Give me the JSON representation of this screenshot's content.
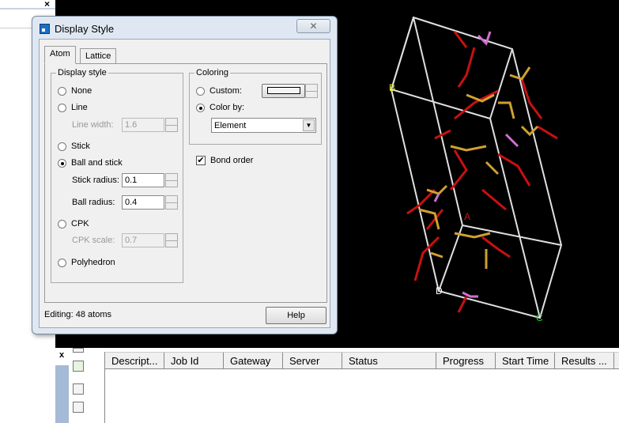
{
  "background_window": {
    "close": "×"
  },
  "dialog": {
    "title": "Display Style",
    "close": "✕",
    "tabs": [
      "Atom",
      "Lattice"
    ],
    "display_style": {
      "legend": "Display style",
      "none": "None",
      "line": "Line",
      "line_width_label": "Line width:",
      "line_width": "1.6",
      "stick": "Stick",
      "ball_and_stick": "Ball and stick",
      "stick_radius_label": "Stick radius:",
      "stick_radius": "0.1",
      "ball_radius_label": "Ball radius:",
      "ball_radius": "0.4",
      "cpk": "CPK",
      "cpk_scale_label": "CPK scale:",
      "cpk_scale": "0.7",
      "polyhedron": "Polyhedron",
      "selected": "Ball and stick"
    },
    "coloring": {
      "legend": "Coloring",
      "custom": "Custom:",
      "color_by": "Color by:",
      "color_by_value": "Element",
      "selected": "Color by"
    },
    "bond_order": {
      "label": "Bond order",
      "checked": true
    },
    "status": "Editing: 48 atoms",
    "help": "Help"
  },
  "viewer": {
    "labels": {
      "a": "A",
      "b": "B",
      "c": "C",
      "d": "D"
    },
    "colors": {
      "lattice": "#e0e0e0",
      "oxygen": "#d01010",
      "phosphorus": "#d080d0",
      "other": "#d0a030"
    }
  },
  "jobs": {
    "close": "x",
    "columns": [
      "Descript...",
      "Job Id",
      "Gateway",
      "Server",
      "Status",
      "Progress",
      "Start Time",
      "Results ..."
    ]
  }
}
